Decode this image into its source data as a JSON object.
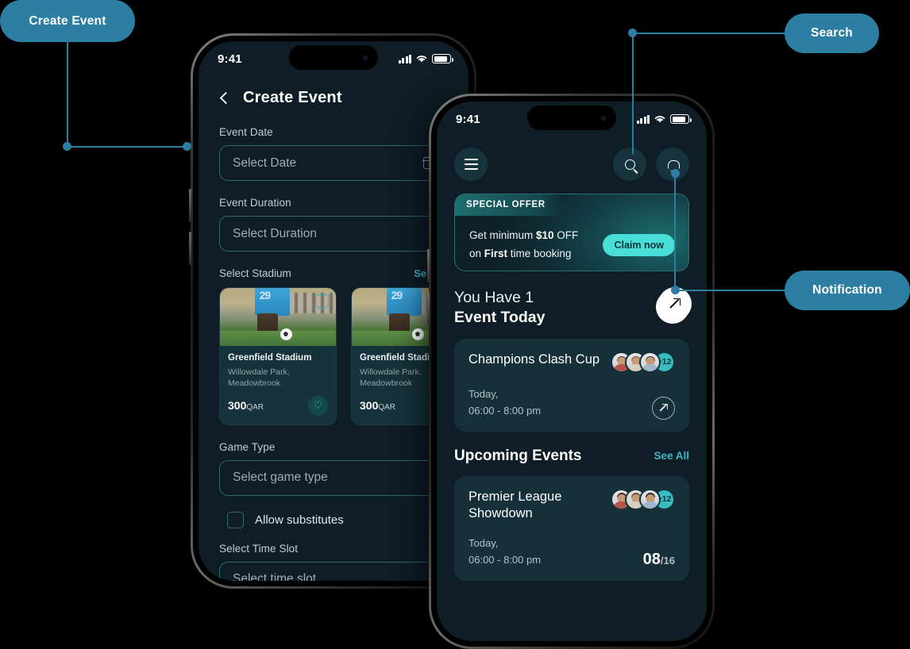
{
  "callouts": [
    {
      "label": "Create Event"
    },
    {
      "label": "Search"
    },
    {
      "label": "Notification"
    }
  ],
  "phone_left": {
    "status": {
      "time": "9:41",
      "signal_icon": "signal-bars-icon",
      "wifi_icon": "wifi-icon",
      "battery_icon": "battery-icon"
    },
    "header": {
      "back_icon": "chevron-left-icon",
      "title": "Create Event"
    },
    "fields": [
      {
        "label": "Event Date",
        "placeholder": "Select Date",
        "icon": "calendar-icon"
      },
      {
        "label": "Event Duration",
        "placeholder": "Select Duration",
        "icon": "chevron-down-icon"
      }
    ],
    "stadium_section": {
      "label": "Select Stadium",
      "see_all": "See All"
    },
    "stadiums": [
      {
        "name": "Greenfield Stadium",
        "location": "Willowdale Park, Meadowbrook",
        "price": "300",
        "currency": "QAR",
        "favorite_icon": "heart-icon",
        "bookmark_icon": "bookmark-icon",
        "jersey_number": "29"
      },
      {
        "name": "Greenfield Stadium",
        "location": "Willowdale Park, Meadowbrook",
        "price": "300",
        "currency": "QAR",
        "favorite_icon": "heart-icon",
        "bookmark_icon": "bookmark-icon",
        "jersey_number": "29"
      }
    ],
    "game_type": {
      "label": "Game Type",
      "placeholder": "Select game type",
      "icon": "chevron-down-icon"
    },
    "checkbox": {
      "label": "Allow substitutes",
      "checked": false
    },
    "time_slot": {
      "label": "Select Time Slot",
      "placeholder": "Select time slot",
      "icon": "chevron-down-icon"
    }
  },
  "phone_right": {
    "status": {
      "time": "9:41",
      "signal_icon": "signal-bars-icon",
      "wifi_icon": "wifi-icon",
      "battery_icon": "battery-icon"
    },
    "header": {
      "menu_icon": "hamburger-menu-icon",
      "search_icon": "search-icon",
      "bell_icon": "notification-bell-icon"
    },
    "offer": {
      "badge": "SPECIAL OFFER",
      "line1_a": "Get minimum ",
      "line1_b": "$10",
      "line1_c": " OFF",
      "line2_a": "on ",
      "line2_b": "First",
      "line2_c": " time booking",
      "cta": "Claim now"
    },
    "today": {
      "line1": "You Have 1",
      "line2": "Event Today",
      "fab_icon": "arrow-up-right-icon"
    },
    "today_event": {
      "name": "Champions Clash Cup",
      "avatars_more": "+12",
      "date": "Today,",
      "time": "06:00 - 8:00 pm",
      "go_icon": "arrow-up-right-icon"
    },
    "upcoming": {
      "title": "Upcoming Events",
      "see_all": "See All"
    },
    "upcoming_event": {
      "name": "Premier League Showdown",
      "avatars_more": "+12",
      "date": "Today,",
      "time": "06:00 - 8:00 pm",
      "count": "08",
      "count_total": "/16"
    }
  },
  "colors": {
    "callout_bg": "#2d7ea3",
    "screen_bg": "#0e1d26",
    "card_bg": "#16303a",
    "accent_teal": "#3fb8c4",
    "cta_teal": "#49dfd9"
  }
}
